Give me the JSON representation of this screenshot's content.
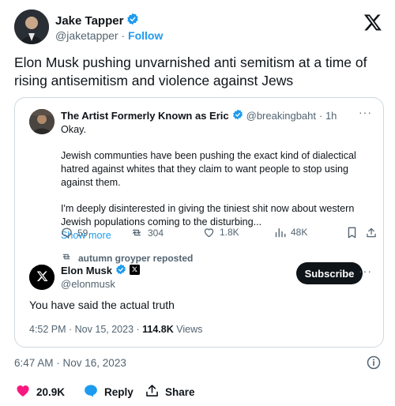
{
  "author": {
    "name": "Jake Tapper",
    "handle": "@jaketapper",
    "separator": "·",
    "follow_label": "Follow"
  },
  "tweet_text": "Elon Musk pushing unvarnished anti semitism at a time of rising antisemitism and violence against Jews",
  "quoted": {
    "name": "The Artist Formerly Known as Eric",
    "handle": "@breakingbaht",
    "time": "· 1h",
    "body": {
      "line1": "Okay.",
      "line2": "Jewish communties have been pushing the exact kind of dialectical hatred against whites that they claim to want people to stop using against them.",
      "line3": "I'm deeply disinterested in giving the tiniest shit now about western Jewish populations coming to the disturbing...",
      "show_more": "Show more"
    },
    "actions": {
      "replies": "59",
      "reposts": "304",
      "likes": "1.8K",
      "views": "48K"
    }
  },
  "repost_label": "autumn groyper reposted",
  "reply": {
    "name": "Elon Musk",
    "handle": "@elonmusk",
    "subscribe_label": "Subscribe",
    "text": "You have said the actual truth",
    "meta_time": "4:52 PM · Nov 15, 2023 ·",
    "meta_views": "114.8K",
    "meta_views_label": "Views"
  },
  "timestamp": "6:47 AM · Nov 16, 2023",
  "footer": {
    "likes": "20.9K",
    "reply_label": "Reply",
    "share_label": "Share"
  },
  "colors": {
    "accent": "#1d9bf0",
    "like": "#f91880",
    "text": "#0f1419",
    "muted": "#536471",
    "border": "#cfd9de"
  },
  "icons": [
    "verified-badge-icon",
    "x-logo-icon",
    "more-icon",
    "reply-icon",
    "repost-icon",
    "like-icon",
    "views-icon",
    "bookmark-icon",
    "share-icon",
    "info-icon",
    "heart-icon",
    "chat-bubble-icon",
    "upload-icon"
  ]
}
